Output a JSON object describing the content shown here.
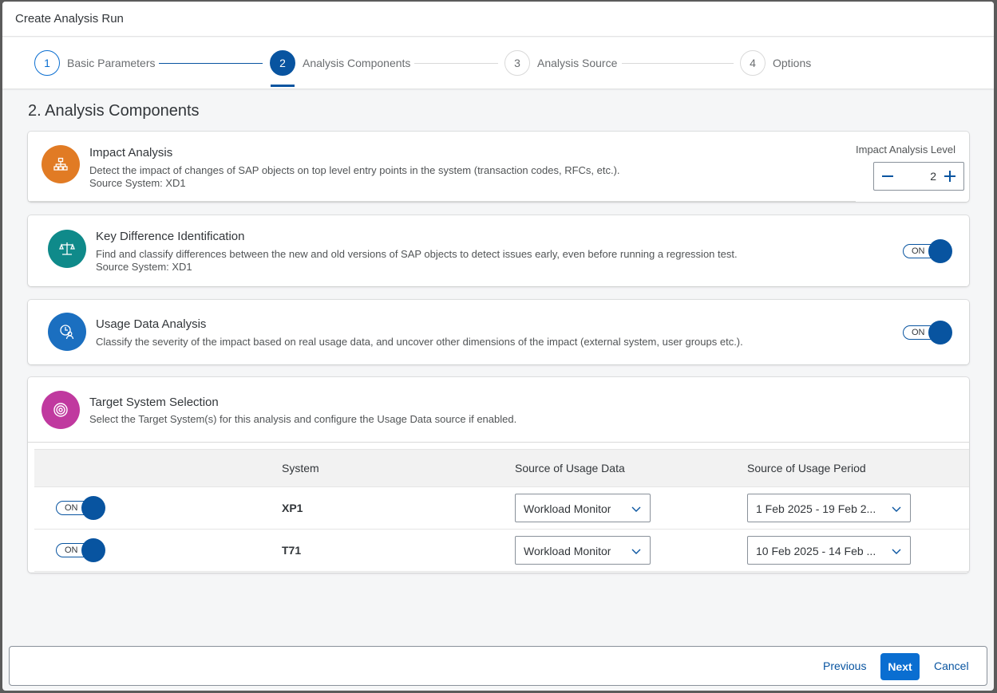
{
  "dialog": {
    "title": "Create Analysis Run"
  },
  "wizard": {
    "steps": [
      {
        "number": "1",
        "label": "Basic Parameters"
      },
      {
        "number": "2",
        "label": "Analysis Components"
      },
      {
        "number": "3",
        "label": "Analysis Source"
      },
      {
        "number": "4",
        "label": "Options"
      }
    ],
    "current_step": 2
  },
  "section_title": "2. Analysis Components",
  "impact": {
    "title": "Impact Analysis",
    "description": "Detect the impact of changes of SAP objects on top level entry points in the system (transaction codes, RFCs, etc.).",
    "source": "Source System: XD1",
    "level_label": "Impact Analysis Level",
    "level_value": "2",
    "icon_color": "#e17b24"
  },
  "kdi": {
    "title": "Key Difference Identification",
    "description": "Find and classify differences between the new and old versions of SAP objects to detect issues early, even before running a regression test.",
    "source": "Source System: XD1",
    "toggle": "ON",
    "icon_color": "#0f8a8a"
  },
  "usage": {
    "title": "Usage Data Analysis",
    "description": "Classify the severity of the impact based on real usage data, and uncover other dimensions of the impact (external system, user groups etc.).",
    "toggle": "ON",
    "icon_color": "#1b6fc0"
  },
  "target": {
    "title": "Target System Selection",
    "description": "Select the Target System(s) for this analysis and configure the Usage Data source if enabled.",
    "icon_color": "#c0399f",
    "columns": [
      "System",
      "Source of Usage Data",
      "Source of Usage Period"
    ],
    "rows": [
      {
        "toggle": "ON",
        "system": "XP1",
        "source": "Workload Monitor",
        "period": "1 Feb 2025 - 19 Feb 2..."
      },
      {
        "toggle": "ON",
        "system": "T71",
        "source": "Workload Monitor",
        "period": "10 Feb 2025 - 14 Feb ..."
      }
    ]
  },
  "footer": {
    "previous": "Previous",
    "next": "Next",
    "cancel": "Cancel"
  }
}
